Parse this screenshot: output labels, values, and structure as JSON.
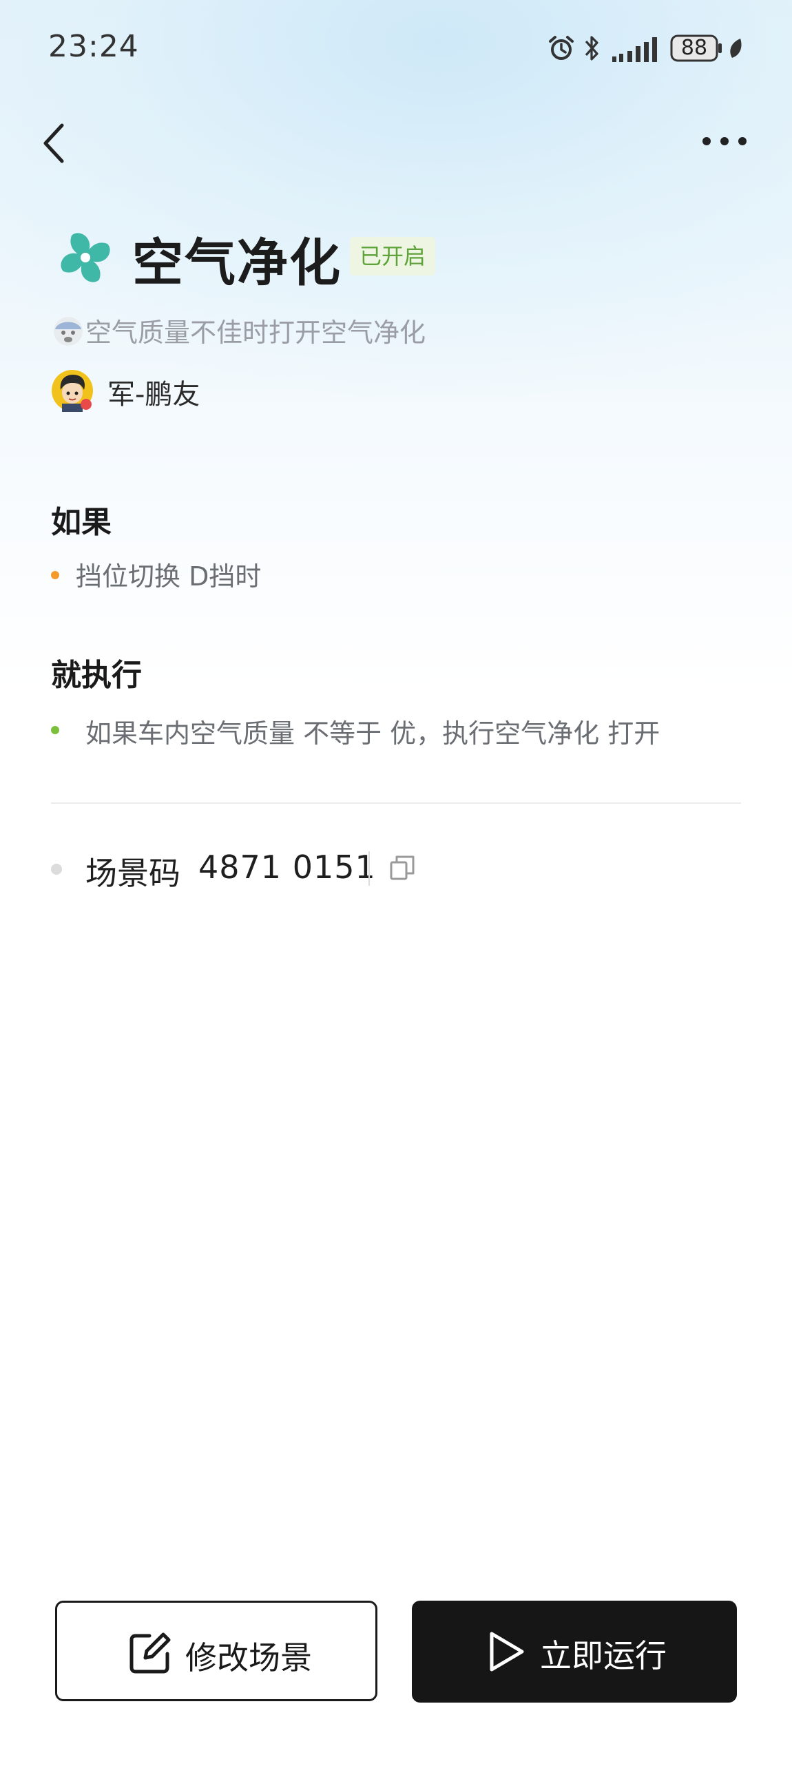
{
  "status_bar": {
    "time": "23:24",
    "battery": "88",
    "icons": [
      "alarm-icon",
      "bluetooth-icon",
      "signal-icon",
      "battery-icon",
      "leaf-icon"
    ]
  },
  "nav": {
    "back_icon": "chevron-left-icon",
    "more_icon": "more-horizontal-icon"
  },
  "scene": {
    "icon": "fan-icon",
    "icon_color": "#3fb8a8",
    "title": "空气净化",
    "status": "已开启",
    "status_color": "#5ea23a",
    "description": "空气质量不佳时打开空气净化",
    "author": "军-鹏友"
  },
  "conditions": {
    "heading": "如果",
    "items": [
      {
        "text": "挡位切换 D挡时",
        "dot_color": "#f39a2b"
      }
    ]
  },
  "actions": {
    "heading": "就执行",
    "items": [
      {
        "text": "如果车内空气质量 不等于 优，执行空气净化 打开",
        "dot_color": "#7bbf3a"
      }
    ]
  },
  "scene_code": {
    "label": "场景码",
    "value": "4871 0151",
    "copy_icon": "copy-icon"
  },
  "buttons": {
    "edit_label": "修改场景",
    "edit_icon": "edit-icon",
    "run_label": "立即运行",
    "run_icon": "play-icon"
  }
}
